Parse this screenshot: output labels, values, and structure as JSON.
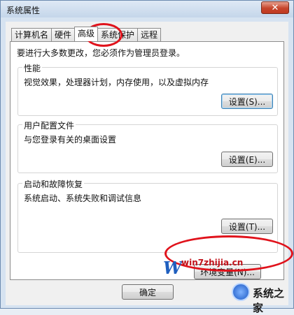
{
  "window": {
    "title": "系统属性",
    "close_glyph": "✕"
  },
  "tabs": [
    {
      "label": "计算机名"
    },
    {
      "label": "硬件"
    },
    {
      "label": "高级"
    },
    {
      "label": "系统保护"
    },
    {
      "label": "远程"
    }
  ],
  "notice": "要进行大多数更改，您必须作为管理员登录。",
  "groups": {
    "performance": {
      "title": "性能",
      "desc": "视觉效果，处理器计划，内存使用，以及虚拟内存",
      "button": "设置(S)..."
    },
    "profile": {
      "title": "用户配置文件",
      "desc": "与您登录有关的桌面设置",
      "button": "设置(E)..."
    },
    "startup": {
      "title": "启动和故障恢复",
      "desc": "系统启动、系统失败和调试信息",
      "button": "设置(T)..."
    }
  },
  "env_button": "环境变量(N)...",
  "footer": {
    "ok": "确定"
  },
  "watermark": {
    "site": "win7zhijia.cn",
    "brand": "系统之家"
  },
  "colors": {
    "highlight": "#e0121b",
    "accent": "#3c7fb1"
  },
  "active_tab": "高级"
}
